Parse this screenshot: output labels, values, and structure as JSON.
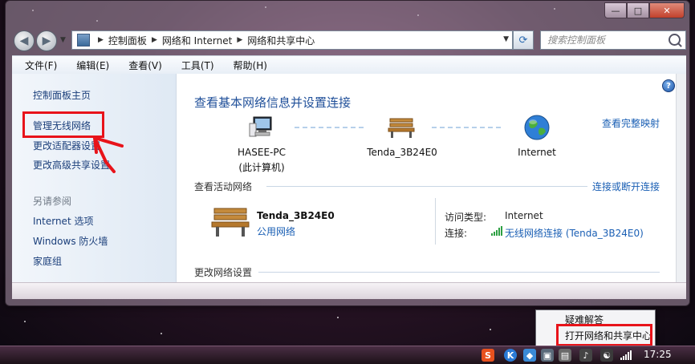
{
  "window": {
    "caption": {
      "minimize": "—",
      "maximize": "□",
      "close": "✕"
    }
  },
  "nav": {
    "back_icon": "back-arrow-icon",
    "forward_icon": "forward-arrow-icon",
    "breadcrumb": [
      "控制面板",
      "网络和 Internet",
      "网络和共享中心"
    ],
    "search_placeholder": "搜索控制面板"
  },
  "menubar": {
    "items": [
      "文件(F)",
      "编辑(E)",
      "查看(V)",
      "工具(T)",
      "帮助(H)"
    ]
  },
  "sidebar": {
    "items": [
      "控制面板主页",
      "管理无线网络",
      "更改适配器设置",
      "更改高级共享设置"
    ],
    "see_also_heading": "另请参阅",
    "see_also": [
      "Internet 选项",
      "Windows 防火墙",
      "家庭组"
    ]
  },
  "main": {
    "title": "查看基本网络信息并设置连接",
    "full_map_link": "查看完整映射",
    "nodes": [
      {
        "name": "HASEE-PC",
        "sub": "(此计算机)",
        "icon": "computer-icon"
      },
      {
        "name": "Tenda_3B24E0",
        "icon": "bench-icon"
      },
      {
        "name": "Internet",
        "icon": "globe-icon"
      }
    ],
    "active_networks_title": "查看活动网络",
    "connect_link": "连接或断开连接",
    "active_network": {
      "name": "Tenda_3B24E0",
      "type_link": "公用网络",
      "access_type_label": "访问类型:",
      "access_type_value": "Internet",
      "connection_label": "连接:",
      "connection_value": "无线网络连接 (Tenda_3B24E0)"
    },
    "change_settings_title": "更改网络设置"
  },
  "tray_popup": {
    "items": [
      "疑难解答",
      "打开网络和共享中心"
    ]
  },
  "taskbar": {
    "clock": "17:25"
  },
  "colors": {
    "link": "#1a5fb4",
    "title": "#1f4f99",
    "annotation_red": "#e8131a"
  }
}
